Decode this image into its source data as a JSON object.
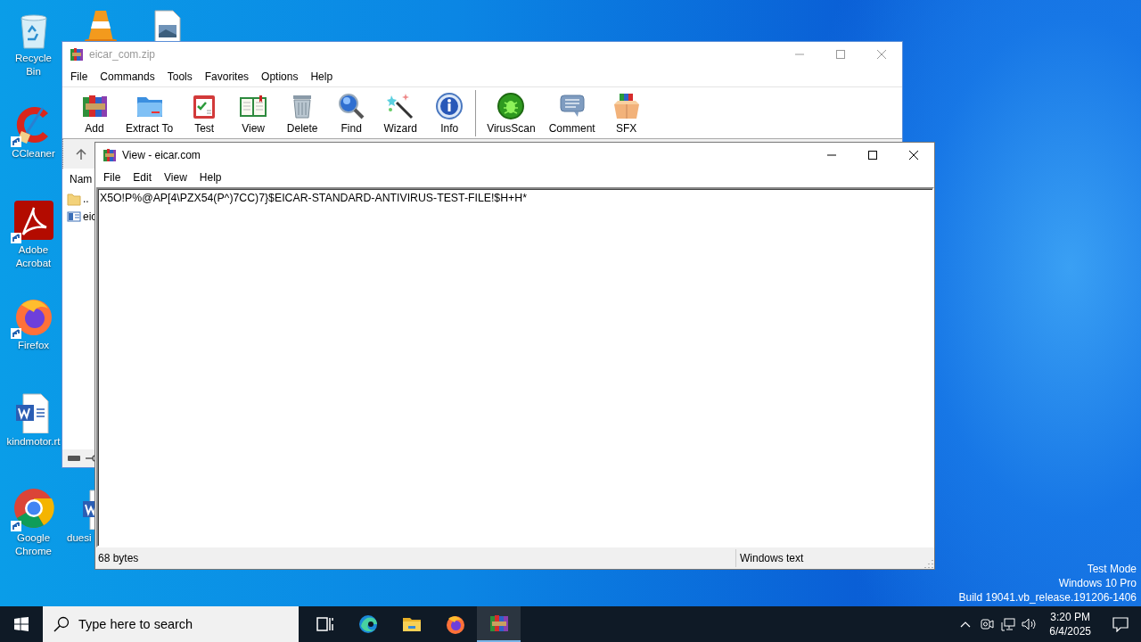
{
  "desktop_icons": [
    {
      "kind": "recycle-bin",
      "label": "Recycle Bin",
      "shortcut": false
    },
    {
      "kind": "cone",
      "shortcut": false
    },
    {
      "kind": "image-file",
      "shortcut": false
    },
    {
      "kind": "ccleaner",
      "label": "CCleaner",
      "shortcut": true
    },
    {
      "kind": "pdf",
      "label": "Adobe Acrobat",
      "shortcut": true
    },
    {
      "kind": "firefox",
      "label": "Firefox",
      "shortcut": true
    },
    {
      "kind": "word",
      "label": "kindmotor.rt",
      "shortcut": false
    },
    {
      "kind": "chrome",
      "label": "Google Chrome",
      "shortcut": true
    },
    {
      "kind": "word",
      "label": "duesi",
      "shortcut": false
    }
  ],
  "archive_window": {
    "title": "eicar_com.zip",
    "active": false,
    "menu": [
      "File",
      "Commands",
      "Tools",
      "Favorites",
      "Options",
      "Help"
    ],
    "toolbar": [
      {
        "kind": "add",
        "label": "Add"
      },
      {
        "kind": "extract",
        "label": "Extract To"
      },
      {
        "kind": "test",
        "label": "Test"
      },
      {
        "kind": "view",
        "label": "View"
      },
      {
        "kind": "delete",
        "label": "Delete"
      },
      {
        "kind": "find",
        "label": "Find"
      },
      {
        "kind": "wizard",
        "label": "Wizard"
      },
      {
        "kind": "info",
        "label": "Info"
      },
      {
        "kind": "separator"
      },
      {
        "kind": "virusscan",
        "label": "VirusScan"
      },
      {
        "kind": "comment",
        "label": "Comment"
      },
      {
        "kind": "sfx",
        "label": "SFX"
      }
    ],
    "column_header": "Nam",
    "files": [
      {
        "kind": "folder",
        "name": ".."
      },
      {
        "kind": "file",
        "name": "eic"
      }
    ]
  },
  "viewer_window": {
    "title": "View - eicar.com",
    "active": true,
    "menu": [
      "File",
      "Edit",
      "View",
      "Help"
    ],
    "content": "X5O!P%@AP[4\\PZX54(P^)7CC)7}$EICAR-STANDARD-ANTIVIRUS-TEST-FILE!$H+H*",
    "status": [
      "68 bytes",
      "Windows text"
    ]
  },
  "system_watermark": [
    "Test Mode",
    "Windows 10 Pro",
    "Build 19041.vb_release.191206-1406"
  ],
  "taskbar": {
    "search_placeholder": "Type here to search",
    "apps": [
      {
        "kind": "task-view",
        "selected": false
      },
      {
        "kind": "edge",
        "selected": false
      },
      {
        "kind": "explorer",
        "selected": false
      },
      {
        "kind": "firefox",
        "selected": false
      },
      {
        "kind": "winrar",
        "selected": true
      }
    ],
    "time": "3:20 PM",
    "date": "6/4/2025"
  }
}
